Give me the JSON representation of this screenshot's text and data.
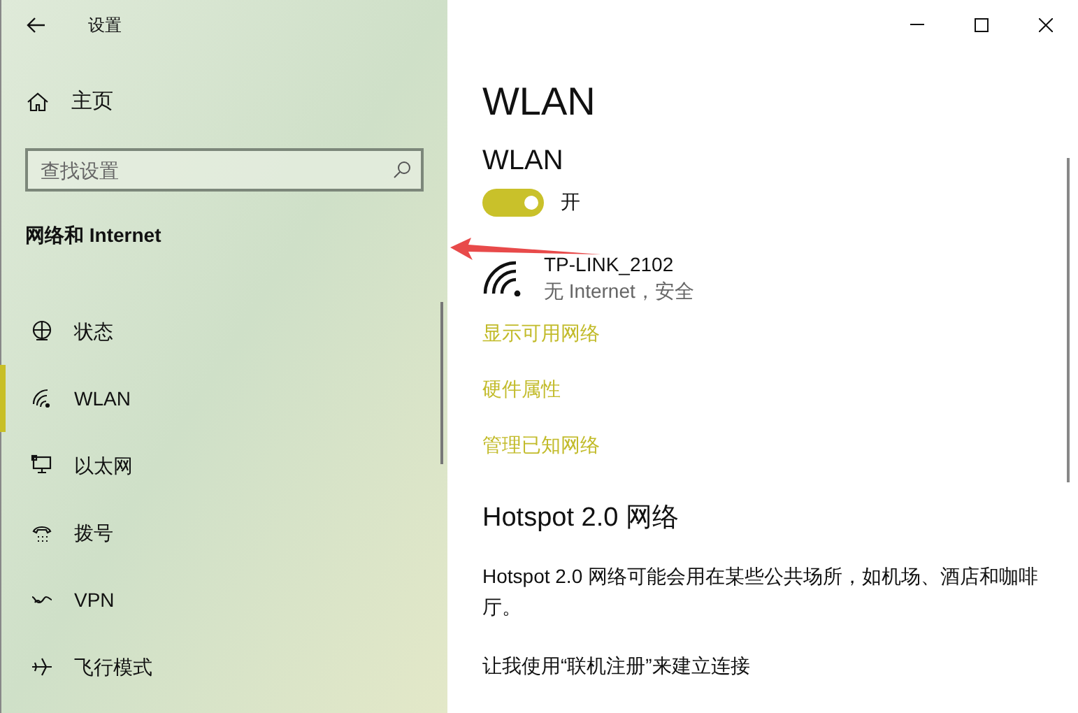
{
  "window": {
    "title": "设置"
  },
  "sidebar": {
    "home": "主页",
    "search": {
      "placeholder": "查找设置"
    },
    "section": "网络和 Internet",
    "items": [
      {
        "kind": "status",
        "label": "状态",
        "selected": false
      },
      {
        "kind": "wifi",
        "label": "WLAN",
        "selected": true
      },
      {
        "kind": "ethernet",
        "label": "以太网",
        "selected": false
      },
      {
        "kind": "dialup",
        "label": "拨号",
        "selected": false
      },
      {
        "kind": "vpn",
        "label": "VPN",
        "selected": false
      },
      {
        "kind": "airplane",
        "label": "飞行模式",
        "selected": false
      }
    ]
  },
  "main": {
    "title": "WLAN",
    "section": "WLAN",
    "toggle": {
      "on": true,
      "label": "开"
    },
    "network": {
      "name": "TP-LINK_2102",
      "status": "无 Internet，安全"
    },
    "links": [
      "显示可用网络",
      "硬件属性",
      "管理已知网络"
    ],
    "hotspot": {
      "heading": "Hotspot 2.0 网络",
      "description": "Hotspot 2.0 网络可能会用在某些公共场所，如机场、酒店和咖啡厅。",
      "option": "让我使用“联机注册”来建立连接"
    }
  }
}
